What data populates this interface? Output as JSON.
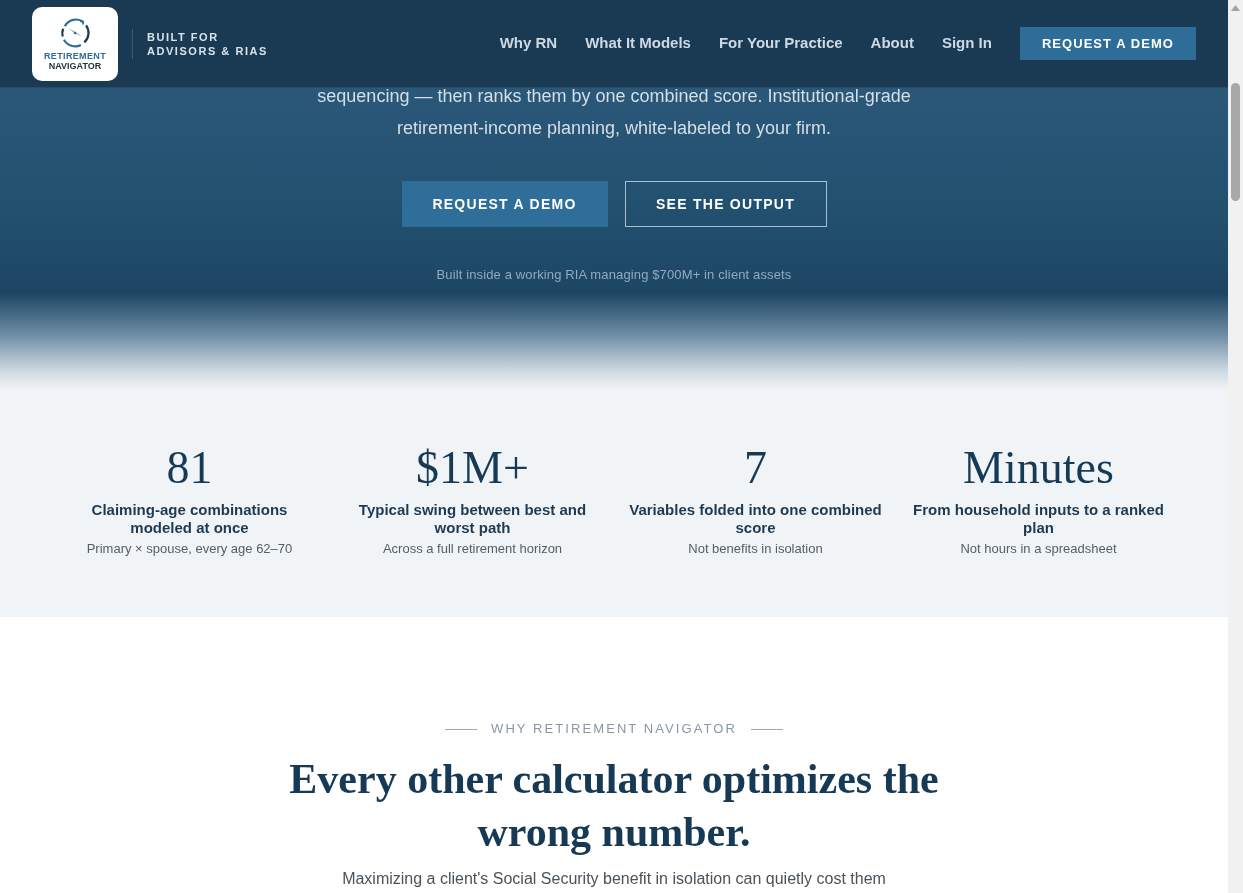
{
  "header": {
    "logo": {
      "line1": "RETIREMENT",
      "line2": "NAVIGATOR"
    },
    "tagline": [
      "BUILT FOR",
      "ADVISORS & RIAS"
    ],
    "nav": [
      "Why RN",
      "What It Models",
      "For Your Practice",
      "About",
      "Sign In"
    ],
    "cta": "REQUEST A DEMO"
  },
  "hero": {
    "description_lines": [
      "sequencing — then ranks them by one combined score. Institutional-grade",
      "retirement-income planning, white-labeled to your firm."
    ],
    "buttons": [
      {
        "label": "REQUEST A DEMO",
        "kind": "primary"
      },
      {
        "label": "SEE THE OUTPUT",
        "kind": "outline"
      }
    ],
    "note": "Built inside a working RIA managing $700M+ in client assets"
  },
  "stats": [
    {
      "value": "81",
      "label": "Claiming-age combinations modeled at once",
      "detail": "Primary × spouse, every age 62–70"
    },
    {
      "value": "$1M+",
      "label": "Typical swing between best and worst path",
      "detail": "Across a full retirement horizon"
    },
    {
      "value": "7",
      "label": "Variables folded into one combined score",
      "detail": "Not benefits in isolation"
    },
    {
      "value": "Minutes",
      "label": "From household inputs to a ranked plan",
      "detail": "Not hours in a spreadsheet"
    }
  ],
  "why_section": {
    "eyebrow": "WHY RETIREMENT NAVIGATOR",
    "heading": "Every other calculator optimizes the wrong number.",
    "intro": "Maximizing a client's Social Security benefit in isolation can quietly cost them"
  }
}
